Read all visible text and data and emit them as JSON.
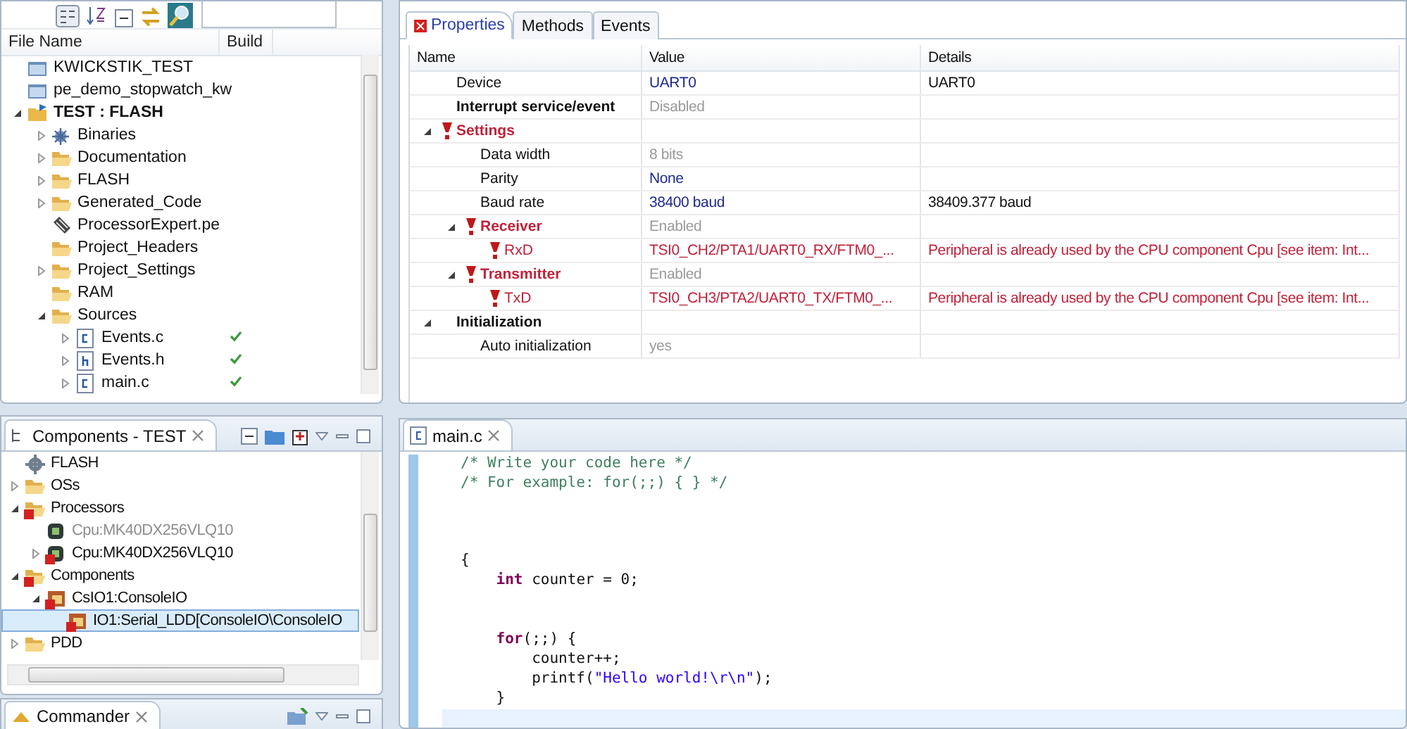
{
  "project_explorer": {
    "columns": [
      "File Name",
      "Build"
    ],
    "items": [
      {
        "label": "KWICKSTIK_TEST",
        "kind": "closed-project"
      },
      {
        "label": "pe_demo_stopwatch_kw",
        "kind": "closed-project"
      },
      {
        "label": "TEST : FLASH",
        "kind": "project",
        "bold": true,
        "expanded": true,
        "children": [
          {
            "label": "Binaries",
            "kind": "binaries",
            "expanded": false
          },
          {
            "label": "Documentation",
            "kind": "folder",
            "expanded": false
          },
          {
            "label": "FLASH",
            "kind": "folder",
            "expanded": false
          },
          {
            "label": "Generated_Code",
            "kind": "folder",
            "expanded": false
          },
          {
            "label": "ProcessorExpert.pe",
            "kind": "pe-file"
          },
          {
            "label": "Project_Headers",
            "kind": "folder"
          },
          {
            "label": "Project_Settings",
            "kind": "folder",
            "expanded": false
          },
          {
            "label": "RAM",
            "kind": "folder"
          },
          {
            "label": "Sources",
            "kind": "folder",
            "expanded": true,
            "children": [
              {
                "label": "Events.c",
                "kind": "c-file",
                "expanded": false,
                "built": true
              },
              {
                "label": "Events.h",
                "kind": "h-file",
                "expanded": false,
                "built": true
              },
              {
                "label": "main.c",
                "kind": "c-file",
                "expanded": false,
                "built": true
              }
            ]
          }
        ]
      }
    ]
  },
  "components_view": {
    "tab": {
      "title": "Components - TEST"
    },
    "items": [
      {
        "label": "FLASH",
        "kind": "gear"
      },
      {
        "label": "OSs",
        "kind": "folder",
        "expanded": false
      },
      {
        "label": "Processors",
        "kind": "folder",
        "error": true,
        "expanded": true,
        "children": [
          {
            "label": "Cpu:MK40DX256VLQ10",
            "kind": "cpu",
            "disabled": true
          },
          {
            "label": "Cpu:MK40DX256VLQ10",
            "kind": "cpu",
            "error": true,
            "expanded": false
          }
        ]
      },
      {
        "label": "Components",
        "kind": "folder",
        "error": true,
        "expanded": true,
        "children": [
          {
            "label": "CsIO1:ConsoleIO",
            "kind": "component",
            "error": true,
            "expanded": true,
            "children": [
              {
                "label": "IO1:Serial_LDD[ConsoleIO\\ConsoleIO",
                "kind": "component",
                "error": true,
                "selected": true
              }
            ]
          }
        ]
      },
      {
        "label": "PDD",
        "kind": "folder",
        "expanded": false
      }
    ]
  },
  "commander": {
    "tab": {
      "title": "Commander"
    }
  },
  "properties": {
    "tabs": [
      {
        "label": "Properties",
        "selected": true,
        "error": true
      },
      {
        "label": "Methods",
        "selected": false
      },
      {
        "label": "Events",
        "selected": false
      }
    ],
    "columns": [
      "Name",
      "Value",
      "Details"
    ],
    "rows": [
      {
        "name": "Device",
        "value": "UART0",
        "value_disabled": false,
        "details": "UART0"
      },
      {
        "name": "Interrupt service/event",
        "bold": true,
        "value": "Disabled",
        "value_disabled": true
      },
      {
        "name": "Settings",
        "bold": true,
        "error": true,
        "expanded": true,
        "children": [
          {
            "name": "Data width",
            "value": "8 bits",
            "value_disabled": true
          },
          {
            "name": "Parity",
            "value": "None",
            "value_disabled": false
          },
          {
            "name": "Baud rate",
            "value": "38400 baud",
            "value_disabled": false,
            "details": "38409.377 baud"
          },
          {
            "name": "Receiver",
            "bold": true,
            "error": true,
            "expanded": true,
            "value": "Enabled",
            "value_disabled": true,
            "children": [
              {
                "name": "RxD",
                "error": true,
                "value": "TSI0_CH2/PTA1/UART0_RX/FTM0_...",
                "value_error": true,
                "details": "Peripheral is already used by the CPU component Cpu [see item: Int...",
                "details_error": true
              }
            ]
          },
          {
            "name": "Transmitter",
            "bold": true,
            "error": true,
            "expanded": true,
            "value": "Enabled",
            "value_disabled": true,
            "children": [
              {
                "name": "TxD",
                "error": true,
                "value": "TSI0_CH3/PTA2/UART0_TX/FTM0_...",
                "value_error": true,
                "details": "Peripheral is already used by the CPU component Cpu [see item: Int...",
                "details_error": true
              }
            ]
          }
        ]
      },
      {
        "name": "Initialization",
        "bold": true,
        "expanded": true,
        "children": [
          {
            "name": "Auto initialization",
            "value": "yes",
            "value_disabled": true
          }
        ]
      }
    ]
  },
  "editor": {
    "tab": {
      "title": "main.c"
    },
    "lines": [
      {
        "kind": "code",
        "tokens": [
          {
            "text": "/* Write your code here */",
            "kind": "comment"
          }
        ]
      },
      {
        "kind": "code",
        "tokens": [
          {
            "text": "/* For example: for(;;) { } */",
            "kind": "comment"
          }
        ]
      },
      {
        "kind": "blank"
      },
      {
        "kind": "blank"
      },
      {
        "kind": "blank"
      },
      {
        "kind": "code",
        "tokens": [
          {
            "text": "{",
            "kind": "plain"
          }
        ]
      },
      {
        "kind": "code",
        "tokens": [
          {
            "text": "    int",
            "kind": "keyword"
          },
          {
            "text": " counter = 0;",
            "kind": "plain"
          }
        ]
      },
      {
        "kind": "blank"
      },
      {
        "kind": "blank"
      },
      {
        "kind": "code",
        "tokens": [
          {
            "text": "    for",
            "kind": "keyword"
          },
          {
            "text": "(;;) {",
            "kind": "plain"
          }
        ]
      },
      {
        "kind": "code",
        "tokens": [
          {
            "text": "        counter++;",
            "kind": "plain"
          }
        ]
      },
      {
        "kind": "code",
        "tokens": [
          {
            "text": "        printf(",
            "kind": "plain"
          },
          {
            "text": "\"Hello world!\\r\\n\"",
            "kind": "string"
          },
          {
            "text": ");",
            "kind": "plain"
          }
        ]
      },
      {
        "kind": "code",
        "tokens": [
          {
            "text": "    }",
            "kind": "plain"
          }
        ]
      },
      {
        "kind": "blank",
        "current": true
      }
    ]
  }
}
